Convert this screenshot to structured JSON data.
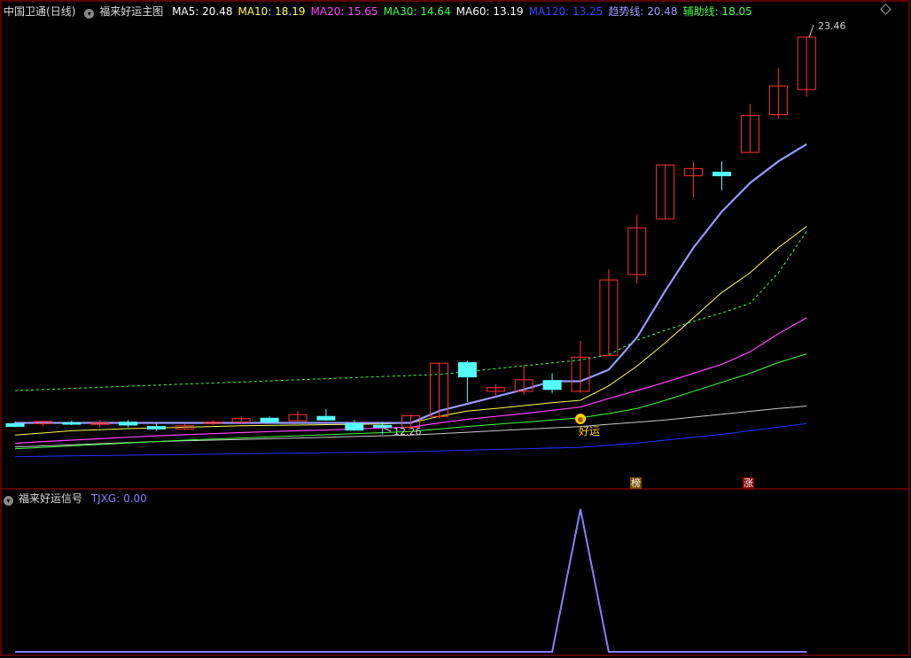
{
  "header": {
    "stock_name": "中国卫通",
    "period": "(日线)",
    "indicator_name": "福来好运主图",
    "ma_readouts": [
      {
        "label": "MA5: 20.48",
        "color": "#ffffff"
      },
      {
        "label": "MA10: 18.19",
        "color": "#ffff55"
      },
      {
        "label": "MA20: 15.65",
        "color": "#ff44ff"
      },
      {
        "label": "MA30: 14.64",
        "color": "#44ff44"
      },
      {
        "label": "MA60: 13.19",
        "color": "#ffffff"
      },
      {
        "label": "MA120: 13.25",
        "color": "#3344ff"
      },
      {
        "label": "趋势线: 20.48",
        "color": "#9999ff"
      },
      {
        "label": "辅助线: 18.05",
        "color": "#44ff44"
      }
    ]
  },
  "sub_header": {
    "indicator_name": "福来好运信号",
    "readout": "TJXG: 0.00"
  },
  "markers": {
    "high_label": "23.46",
    "low_label": "12.26",
    "signal_label": "好运",
    "tag_bang": "榜",
    "tag_zhang": "涨"
  },
  "colors": {
    "up": "#ff3333",
    "down": "#54fcfc",
    "frame": "#b40000",
    "trend": "#9999ff",
    "aux": "#44ff44",
    "ma5": "#ffffff",
    "ma10": "#ffff55",
    "ma20": "#ff44ff",
    "ma30": "#44ff44",
    "ma60": "#cccccc",
    "ma120": "#2233ff",
    "signal": "#8a7cff"
  },
  "chart_data": {
    "type": "candlestick",
    "price_range": [
      11.5,
      24.0
    ],
    "candles": [
      {
        "o": 12.7,
        "h": 12.75,
        "l": 12.6,
        "c": 12.62
      },
      {
        "o": 12.7,
        "h": 12.78,
        "l": 12.62,
        "c": 12.76
      },
      {
        "o": 12.72,
        "h": 12.78,
        "l": 12.66,
        "c": 12.7
      },
      {
        "o": 12.68,
        "h": 12.8,
        "l": 12.6,
        "c": 12.72
      },
      {
        "o": 12.74,
        "h": 12.8,
        "l": 12.6,
        "c": 12.66
      },
      {
        "o": 12.62,
        "h": 12.7,
        "l": 12.5,
        "c": 12.55
      },
      {
        "o": 12.55,
        "h": 12.7,
        "l": 12.52,
        "c": 12.64
      },
      {
        "o": 12.72,
        "h": 12.8,
        "l": 12.66,
        "c": 12.74
      },
      {
        "o": 12.74,
        "h": 12.9,
        "l": 12.7,
        "c": 12.84
      },
      {
        "o": 12.85,
        "h": 12.9,
        "l": 12.7,
        "c": 12.75
      },
      {
        "o": 12.78,
        "h": 13.05,
        "l": 12.76,
        "c": 12.95
      },
      {
        "o": 12.9,
        "h": 13.1,
        "l": 12.78,
        "c": 12.8
      },
      {
        "o": 12.7,
        "h": 12.8,
        "l": 12.5,
        "c": 12.52
      },
      {
        "o": 12.65,
        "h": 12.75,
        "l": 12.4,
        "c": 12.6
      },
      {
        "o": 12.6,
        "h": 12.95,
        "l": 12.58,
        "c": 12.92
      },
      {
        "o": 12.9,
        "h": 14.4,
        "l": 12.85,
        "c": 14.38
      },
      {
        "o": 14.4,
        "h": 14.45,
        "l": 13.3,
        "c": 14.0
      },
      {
        "o": 13.6,
        "h": 13.8,
        "l": 13.45,
        "c": 13.7
      },
      {
        "o": 13.6,
        "h": 14.35,
        "l": 13.5,
        "c": 13.92
      },
      {
        "o": 13.9,
        "h": 14.1,
        "l": 13.55,
        "c": 13.65
      },
      {
        "o": 13.6,
        "h": 15.0,
        "l": 13.55,
        "c": 14.55
      },
      {
        "o": 14.6,
        "h": 17.0,
        "l": 14.6,
        "c": 16.7
      },
      {
        "o": 16.85,
        "h": 18.5,
        "l": 16.6,
        "c": 18.15
      },
      {
        "o": 18.4,
        "h": 19.9,
        "l": 18.4,
        "c": 19.9
      },
      {
        "o": 19.6,
        "h": 20.0,
        "l": 19.0,
        "c": 19.8
      },
      {
        "o": 19.7,
        "h": 20.0,
        "l": 19.2,
        "c": 19.6
      },
      {
        "o": 20.25,
        "h": 21.6,
        "l": 20.25,
        "c": 21.28
      },
      {
        "o": 21.3,
        "h": 22.6,
        "l": 21.2,
        "c": 22.1
      },
      {
        "o": 22.0,
        "h": 23.46,
        "l": 21.8,
        "c": 23.46
      }
    ],
    "lines": {
      "trend": [
        12.72,
        12.72,
        12.72,
        12.72,
        12.72,
        12.72,
        12.72,
        12.72,
        12.72,
        12.72,
        12.72,
        12.72,
        12.72,
        12.72,
        12.72,
        13.05,
        13.25,
        13.45,
        13.65,
        13.88,
        13.88,
        14.2,
        15.1,
        16.4,
        17.6,
        18.6,
        19.4,
        20.0,
        20.48
      ],
      "aux": [
        13.62,
        13.65,
        13.68,
        13.71,
        13.74,
        13.77,
        13.8,
        13.83,
        13.86,
        13.89,
        13.92,
        13.95,
        13.98,
        14.01,
        14.04,
        14.07,
        14.15,
        14.23,
        14.31,
        14.39,
        14.47,
        14.62,
        15.02,
        15.3,
        15.55,
        15.78,
        16.05,
        16.9,
        18.05
      ],
      "ma10": [
        12.38,
        12.44,
        12.5,
        12.53,
        12.56,
        12.58,
        12.6,
        12.62,
        12.64,
        12.65,
        12.66,
        12.67,
        12.68,
        12.69,
        12.72,
        12.9,
        13.05,
        13.12,
        13.2,
        13.28,
        13.35,
        13.75,
        14.3,
        14.95,
        15.65,
        16.35,
        16.9,
        17.6,
        18.19
      ],
      "ma20": [
        12.15,
        12.2,
        12.24,
        12.28,
        12.32,
        12.36,
        12.39,
        12.42,
        12.45,
        12.48,
        12.5,
        12.52,
        12.55,
        12.58,
        12.6,
        12.72,
        12.82,
        12.9,
        12.98,
        13.07,
        13.16,
        13.4,
        13.62,
        13.85,
        14.1,
        14.35,
        14.7,
        15.2,
        15.65
      ],
      "ma30": [
        12.0,
        12.04,
        12.08,
        12.12,
        12.16,
        12.2,
        12.24,
        12.27,
        12.3,
        12.33,
        12.36,
        12.39,
        12.42,
        12.45,
        12.48,
        12.55,
        12.62,
        12.68,
        12.74,
        12.8,
        12.86,
        12.98,
        13.12,
        13.35,
        13.6,
        13.85,
        14.1,
        14.4,
        14.64
      ],
      "ma60": [
        12.05,
        12.08,
        12.11,
        12.14,
        12.17,
        12.2,
        12.22,
        12.24,
        12.26,
        12.28,
        12.3,
        12.32,
        12.34,
        12.36,
        12.38,
        12.42,
        12.46,
        12.5,
        12.54,
        12.58,
        12.62,
        12.68,
        12.74,
        12.8,
        12.88,
        12.96,
        13.04,
        13.12,
        13.19
      ],
      "ma120": [
        11.78,
        11.79,
        11.8,
        11.81,
        11.82,
        11.83,
        11.84,
        11.85,
        11.86,
        11.87,
        11.88,
        11.89,
        11.9,
        11.91,
        11.92,
        11.94,
        11.96,
        11.98,
        12.0,
        12.02,
        12.04,
        12.1,
        12.16,
        12.24,
        12.32,
        12.4,
        12.5,
        12.6,
        12.7
      ]
    },
    "signal": {
      "name": "TJXG",
      "range": [
        0,
        1
      ],
      "values": [
        0,
        0,
        0,
        0,
        0,
        0,
        0,
        0,
        0,
        0,
        0,
        0,
        0,
        0,
        0,
        0,
        0,
        0,
        0,
        0,
        1,
        0,
        0,
        0,
        0,
        0,
        0,
        0,
        0
      ]
    }
  }
}
